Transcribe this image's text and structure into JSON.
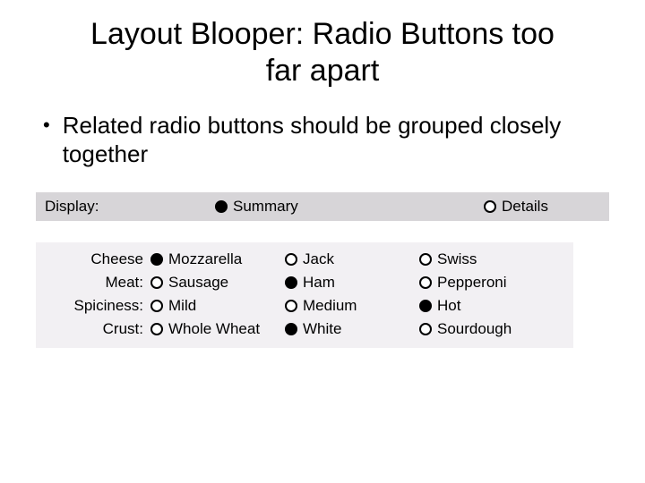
{
  "title_line1": "Layout Blooper: Radio Buttons too",
  "title_line2": "far apart",
  "bullet": "Related radio buttons should be grouped closely together",
  "display": {
    "label": "Display:",
    "options": [
      {
        "label": "Summary",
        "checked": true
      },
      {
        "label": "Details",
        "checked": false
      }
    ]
  },
  "rows": [
    {
      "label": "Cheese",
      "options": [
        {
          "label": "Mozzarella",
          "checked": true
        },
        {
          "label": "Jack",
          "checked": false
        },
        {
          "label": "Swiss",
          "checked": false
        }
      ]
    },
    {
      "label": "Meat:",
      "options": [
        {
          "label": "Sausage",
          "checked": false
        },
        {
          "label": "Ham",
          "checked": true
        },
        {
          "label": "Pepperoni",
          "checked": false
        }
      ]
    },
    {
      "label": "Spiciness:",
      "options": [
        {
          "label": "Mild",
          "checked": false
        },
        {
          "label": "Medium",
          "checked": false
        },
        {
          "label": "Hot",
          "checked": true
        }
      ]
    },
    {
      "label": "Crust:",
      "options": [
        {
          "label": "Whole Wheat",
          "checked": false
        },
        {
          "label": "White",
          "checked": true
        },
        {
          "label": "Sourdough",
          "checked": false
        }
      ]
    }
  ]
}
